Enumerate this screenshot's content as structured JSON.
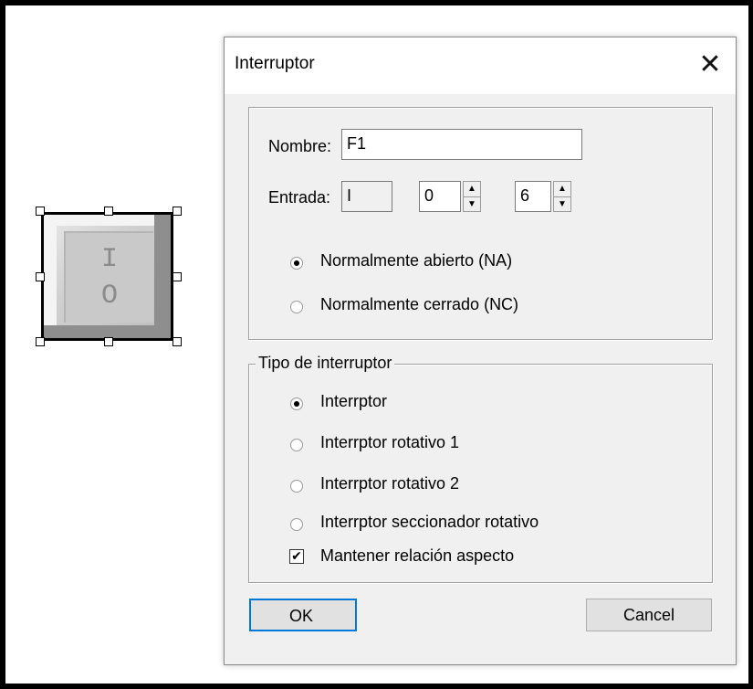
{
  "dialog": {
    "title": "Interruptor",
    "close_glyph": "✕",
    "name_label": "Nombre:",
    "name_value": "F1",
    "input_label": "Entrada:",
    "input_type": "I",
    "input_byte": "0",
    "input_bit": "6",
    "contact": {
      "options": [
        "Normalmente abierto (NA)",
        "Normalmente cerrado (NC)"
      ],
      "selected": "Normalmente abierto (NA)"
    },
    "switch_type": {
      "legend": "Tipo de interruptor",
      "options": [
        "Interrptor",
        "Interrptor rotativo 1",
        "Interrptor rotativo 2",
        "Interrptor seccionador rotativo"
      ],
      "selected": "Interrptor"
    },
    "keep_aspect": {
      "label": "Mantener relación aspecto",
      "checked": true,
      "mark": "✔"
    },
    "ok_label": "OK",
    "cancel_label": "Cancel"
  },
  "canvas": {
    "switch_symbols": {
      "top": "I",
      "bottom": "O"
    }
  },
  "colors": {
    "focus_border": "#0078d7",
    "dialog_bg": "#f0f0f0"
  },
  "icons": [
    "close-icon",
    "spin-up-icon",
    "spin-down-icon",
    "check-icon"
  ]
}
